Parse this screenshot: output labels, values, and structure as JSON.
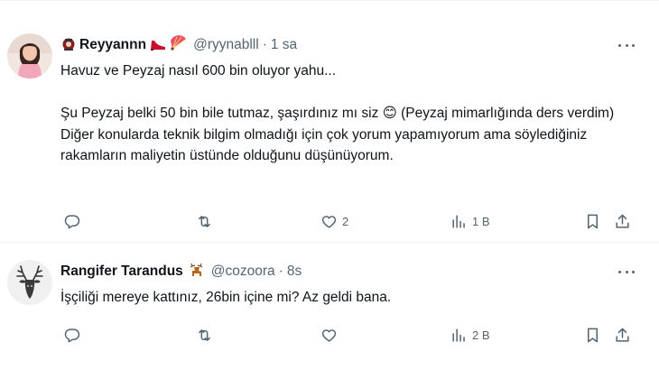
{
  "tweets": [
    {
      "display_name": "Reyyannn",
      "handle": "@ryynablll",
      "separator": "·",
      "time": "1 sa",
      "name_emojis": [
        "lantern-shrine-icon",
        "high-heel-icon",
        "folding-fan-icon"
      ],
      "body": [
        "Havuz ve Peyzaj nasıl 600 bin oluyor yahu...",
        "",
        "Şu Peyzaj belki 50 bin bile tutmaz, şaşırdınız mı siz 😊 (Peyzaj mimarlığında ders verdim)",
        "Diğer konularda teknik bilgim olmadığı için çok yorum yapamıyorum ama söylediğiniz rakamların maliyetin üstünde olduğunu düşünüyorum."
      ],
      "likes": "2",
      "views": "1 B"
    },
    {
      "display_name": "Rangifer Tarandus",
      "handle": "@cozoora",
      "separator": "·",
      "time": "8s",
      "name_emojis": [
        "deer-icon"
      ],
      "body": [
        "İşçiliği mereye kattınız, 26bin içine mi? Az geldi bana."
      ],
      "likes": "",
      "views": "2 B"
    }
  ],
  "colors": {
    "text": "#0f1419",
    "secondary": "#536471",
    "divider": "#eff3f4"
  }
}
